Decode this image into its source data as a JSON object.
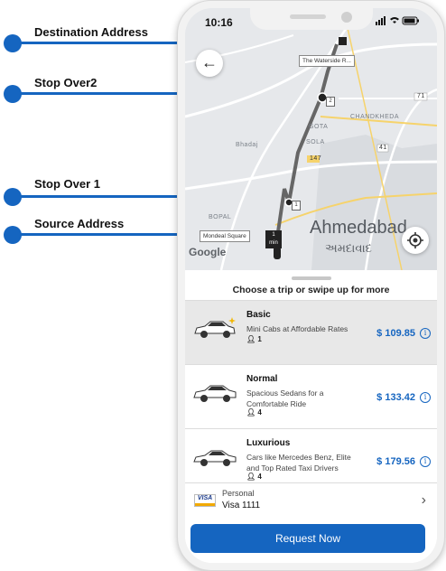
{
  "annotations": {
    "destination": "Destination Address",
    "stopover2": "Stop Over2",
    "stopover1": "Stop Over 1",
    "source": "Source Address"
  },
  "status_bar": {
    "time": "10:16",
    "icons": [
      "location-arrow",
      "signal",
      "wifi",
      "battery"
    ]
  },
  "map": {
    "destination_label": "The Waterside R...",
    "source_label": "Mondeal Square",
    "stop1_number": "1",
    "stop2_number": "2",
    "eta_number": "1",
    "eta_unit": "min",
    "city_name": "Ahmedabad",
    "city_name_gujarati": "અમદાવાદ",
    "area_labels": [
      "GOTA",
      "CHANDKHEDA",
      "Bhadaj",
      "BOPAL",
      "SOLA"
    ],
    "road_numbers": [
      "147",
      "71",
      "41"
    ],
    "attribution": "Google"
  },
  "sheet": {
    "title": "Choose a trip or swipe up for more",
    "options": [
      {
        "name": "Basic",
        "description": "Mini Cabs at Affordable Rates",
        "seats": "1",
        "price": "$ 109.85",
        "selected": true
      },
      {
        "name": "Normal",
        "description": "Spacious Sedans for a Comfortable Ride",
        "seats": "4",
        "price": "$ 133.42",
        "selected": false
      },
      {
        "name": "Luxurious",
        "description": "Cars like Mercedes Benz, Elite and Top Rated Taxi Drivers",
        "seats": "4",
        "price": "$ 179.56",
        "selected": false
      }
    ],
    "payment": {
      "label": "Personal",
      "card": "Visa 1111",
      "brand": "VISA"
    },
    "request_button": "Request Now"
  },
  "colors": {
    "accent": "#1565c0",
    "route": "#666666",
    "selected_bg": "#e8e8e8"
  }
}
